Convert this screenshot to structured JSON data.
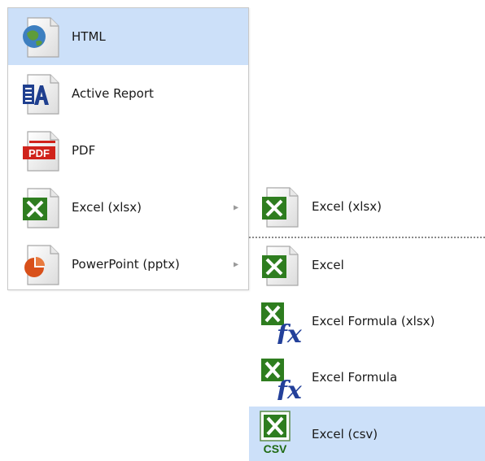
{
  "main_menu": {
    "items": [
      {
        "label": "HTML",
        "icon": "globe-document-icon",
        "highlighted": true
      },
      {
        "label": "Active Report",
        "icon": "active-report-icon"
      },
      {
        "label": "PDF",
        "icon": "pdf-icon"
      },
      {
        "label": "Excel (xlsx)",
        "icon": "excel-icon",
        "has_submenu": true
      },
      {
        "label": "PowerPoint (pptx)",
        "icon": "powerpoint-icon",
        "has_submenu": true
      }
    ],
    "submenu_arrow": "▶"
  },
  "submenu": {
    "items": [
      {
        "label": "Excel (xlsx)",
        "icon": "excel-icon"
      },
      {
        "label": "Excel",
        "icon": "excel-icon"
      },
      {
        "label": "Excel Formula (xlsx)",
        "icon": "excel-formula-icon"
      },
      {
        "label": "Excel Formula",
        "icon": "excel-formula-icon"
      },
      {
        "label": "Excel (csv)",
        "icon": "excel-csv-icon",
        "highlighted": true,
        "icon_text": "CSV"
      }
    ]
  },
  "colors": {
    "highlight": "#cce0f9",
    "excel_green": "#2e7d1f",
    "pdf_red": "#d0231b",
    "ppt_orange": "#d8501a"
  }
}
